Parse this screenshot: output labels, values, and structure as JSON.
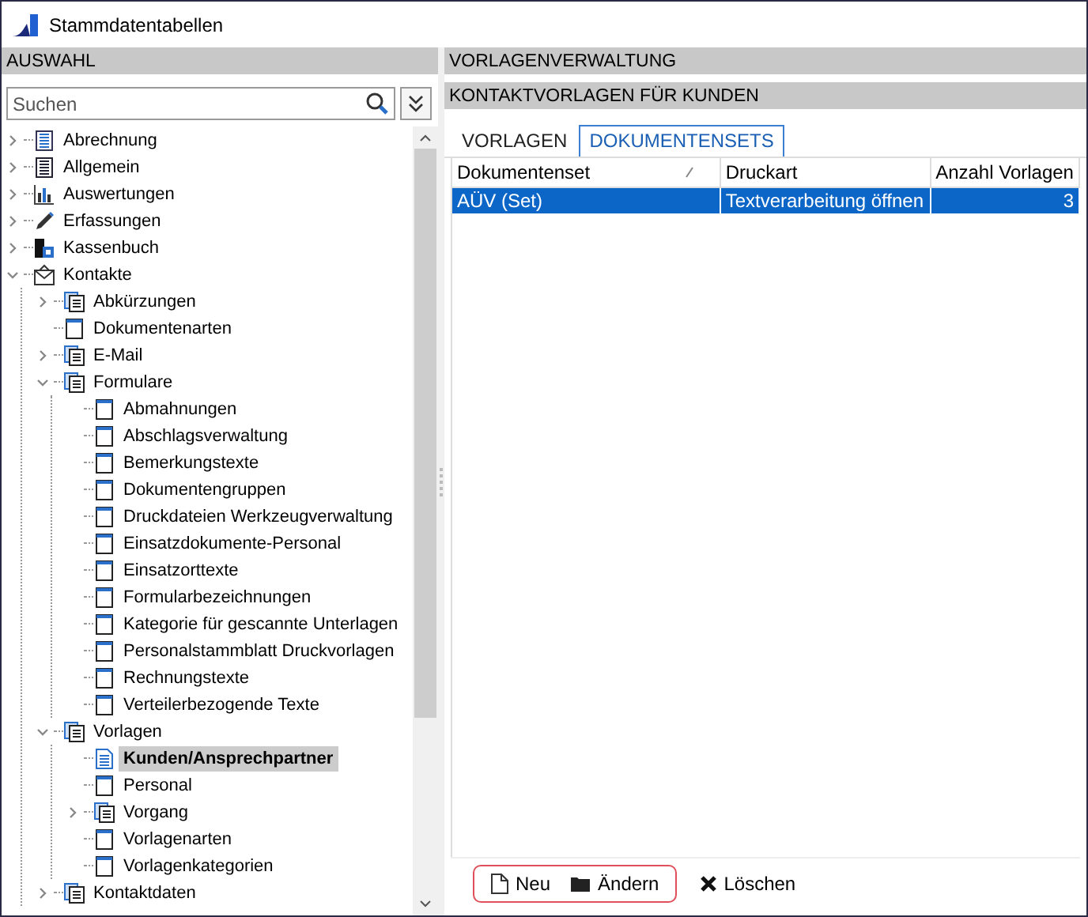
{
  "window": {
    "title": "Stammdatentabellen"
  },
  "left": {
    "header": "AUSWAHL",
    "search": {
      "placeholder": "Suchen"
    },
    "tree": [
      {
        "label": "Abrechnung",
        "kind": "list",
        "expanded": false,
        "selected": false
      },
      {
        "label": "Allgemein",
        "kind": "list-dark",
        "expanded": false,
        "selected": false
      },
      {
        "label": "Auswertungen",
        "kind": "chart",
        "expanded": false,
        "selected": false
      },
      {
        "label": "Erfassungen",
        "kind": "pencil",
        "expanded": false,
        "selected": false
      },
      {
        "label": "Kassenbuch",
        "kind": "register",
        "expanded": false,
        "selected": false
      },
      {
        "label": "Kontakte",
        "kind": "mail",
        "expanded": true,
        "selected": false,
        "children": [
          {
            "label": "Abkürzungen",
            "kind": "docs",
            "expanded": false,
            "selected": false
          },
          {
            "label": "Dokumentenarten",
            "kind": "form",
            "selected": false
          },
          {
            "label": "E-Mail",
            "kind": "docs",
            "expanded": false,
            "selected": false
          },
          {
            "label": "Formulare",
            "kind": "docs",
            "expanded": true,
            "selected": false,
            "children": [
              {
                "label": "Abmahnungen",
                "kind": "form",
                "selected": false
              },
              {
                "label": "Abschlagsverwaltung",
                "kind": "form",
                "selected": false
              },
              {
                "label": "Bemerkungstexte",
                "kind": "form",
                "selected": false
              },
              {
                "label": "Dokumentengruppen",
                "kind": "form",
                "selected": false
              },
              {
                "label": "Druckdateien Werkzeugverwaltung",
                "kind": "form",
                "selected": false
              },
              {
                "label": "Einsatzdokumente-Personal",
                "kind": "form",
                "selected": false
              },
              {
                "label": "Einsatzorttexte",
                "kind": "form",
                "selected": false
              },
              {
                "label": "Formularbezeichnungen",
                "kind": "form",
                "selected": false
              },
              {
                "label": "Kategorie für gescannte Unterlagen",
                "kind": "form",
                "selected": false
              },
              {
                "label": "Personalstammblatt Druckvorlagen",
                "kind": "form",
                "selected": false
              },
              {
                "label": "Rechnungstexte",
                "kind": "form",
                "selected": false
              },
              {
                "label": "Verteilerbezogende Texte",
                "kind": "form",
                "selected": false
              }
            ]
          },
          {
            "label": "Vorlagen",
            "kind": "docs",
            "expanded": true,
            "selected": false,
            "children": [
              {
                "label": "Kunden/Ansprechpartner",
                "kind": "text-doc",
                "selected": true
              },
              {
                "label": "Personal",
                "kind": "form",
                "selected": false
              },
              {
                "label": "Vorgang",
                "kind": "docs",
                "expanded": false,
                "selected": false
              },
              {
                "label": "Vorlagenarten",
                "kind": "form",
                "selected": false
              },
              {
                "label": "Vorlagenkategorien",
                "kind": "form",
                "selected": false
              }
            ]
          },
          {
            "label": "Kontaktdaten",
            "kind": "docs",
            "expanded": false,
            "selected": false
          }
        ]
      }
    ]
  },
  "right": {
    "header": "VORLAGENVERWALTUNG",
    "subheader": "KONTAKTVORLAGEN FÜR KUNDEN",
    "tabs": [
      {
        "label": "VORLAGEN",
        "selected": false
      },
      {
        "label": "DOKUMENTENSETS",
        "selected": true
      }
    ],
    "table": {
      "columns": [
        {
          "label": "Dokumentenset",
          "sorted": true
        },
        {
          "label": "Druckart"
        },
        {
          "label": "Anzahl Vorlagen"
        }
      ],
      "rows": [
        {
          "cells": [
            "AÜV (Set)",
            "Textverarbeitung öffnen",
            "3"
          ],
          "selected": true
        }
      ]
    },
    "toolbar": [
      {
        "label": "Neu",
        "kind": "new",
        "highlighted": true
      },
      {
        "label": "Ändern",
        "kind": "edit",
        "highlighted": true
      },
      {
        "label": "Löschen",
        "kind": "delete",
        "highlighted": false
      }
    ]
  }
}
